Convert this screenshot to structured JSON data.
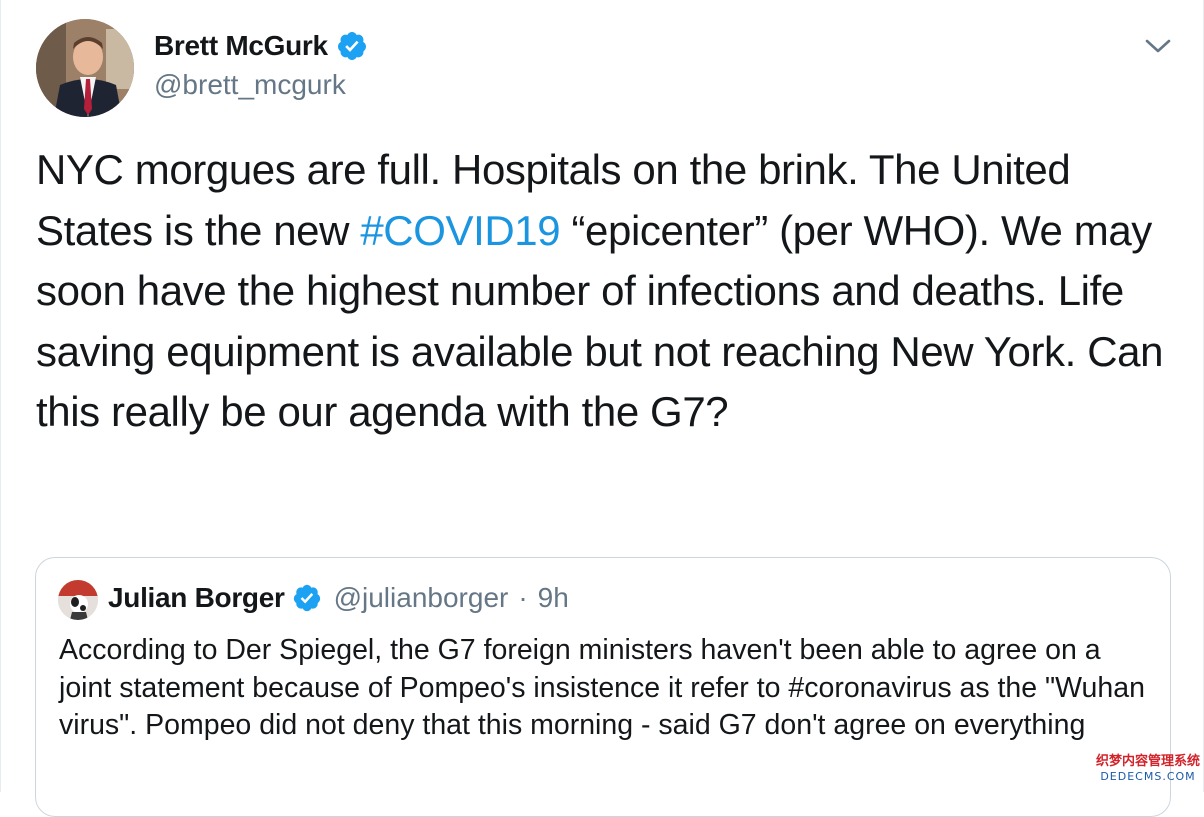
{
  "author": {
    "display_name": "Brett McGurk",
    "handle": "@brett_mcgurk",
    "verified_icon": "verified-badge-icon"
  },
  "tweet": {
    "text_part1": "NYC morgues are full. Hospitals on the brink. The United States is the new ",
    "hashtag": "#COVID19",
    "text_part2": " “epicenter” (per WHO). We may soon have the highest number of infections and deaths. Life saving equipment is available but not reaching New York. Can this really be our agenda with the G7?"
  },
  "quoted": {
    "display_name": "Julian Borger",
    "handle": "@julianborger",
    "separator": "·",
    "time": "9h",
    "text": "According to Der Spiegel, the G7 foreign ministers haven't been able to agree on a joint statement because of Pompeo's insistence it refer to #coronavirus as the \"Wuhan virus\".  Pompeo did not deny that this morning - said G7 don't agree on everything"
  },
  "watermark": {
    "line1": "织梦内容管理系统",
    "line2": "DEDECMS.COM"
  },
  "colors": {
    "link": "#1b95e0",
    "verified": "#1da1f2",
    "secondary_text": "#657786",
    "border": "#ccd6dd"
  }
}
